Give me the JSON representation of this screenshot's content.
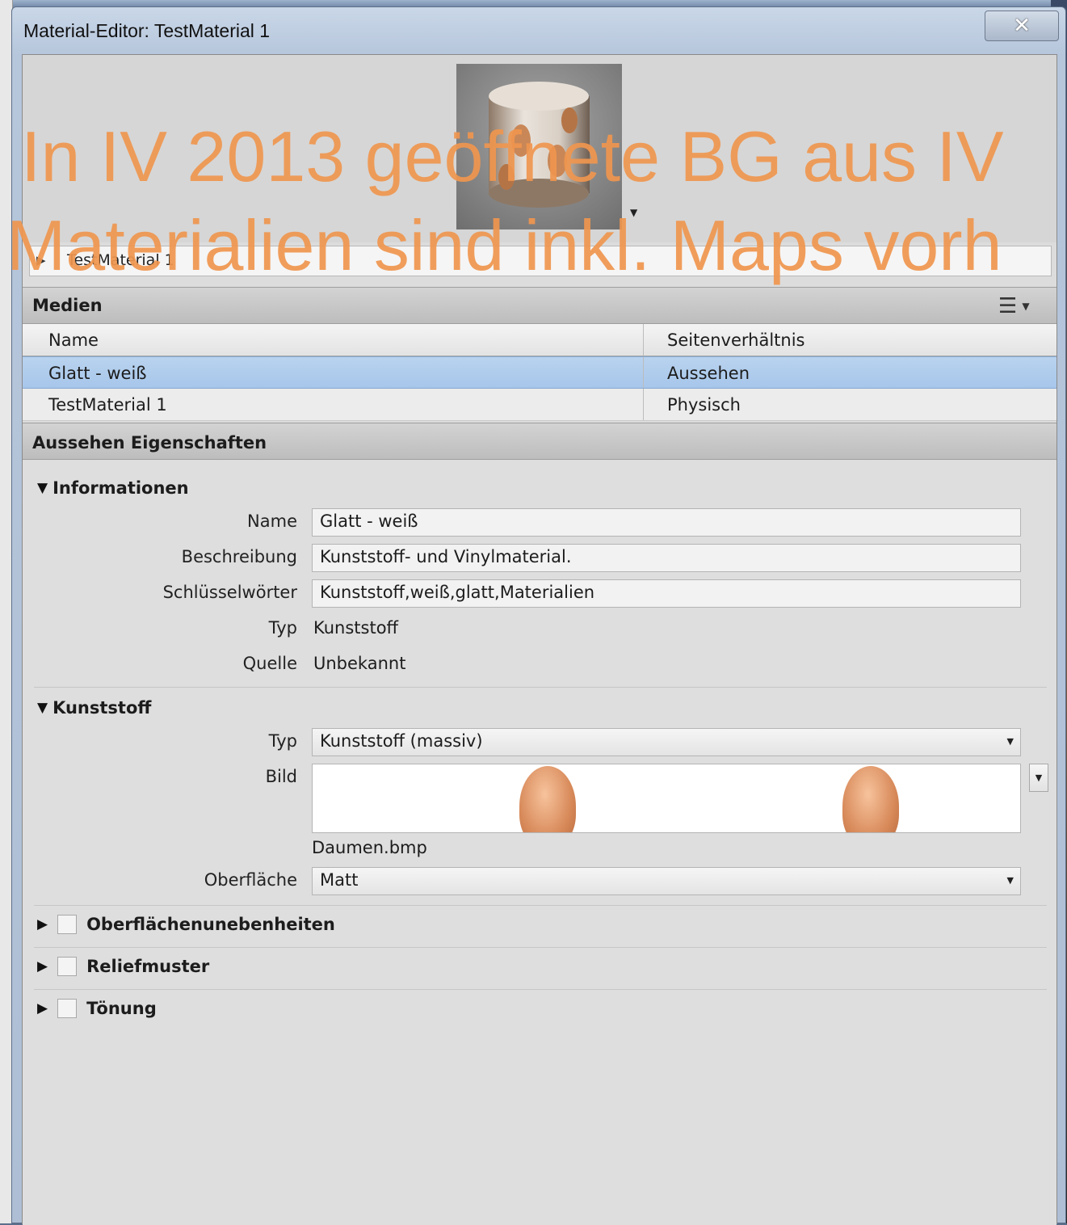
{
  "window": {
    "title": "Material-Editor: TestMaterial 1",
    "close_label": "✕"
  },
  "preview": {
    "material_name": "TestMaterial 1",
    "dropdown_glyph": "▼",
    "expand_glyph": "▶"
  },
  "overlay": {
    "line1": "In IV 2013 geöffnete BG aus IV",
    "line2": "Materialien sind inkl. Maps vorh"
  },
  "medien": {
    "title": "Medien",
    "view_icon": "list-view-icon",
    "columns": [
      "Name",
      "Seitenverhältnis"
    ],
    "rows": [
      {
        "name": "Glatt - weiß",
        "aspect": "Aussehen",
        "selected": true
      },
      {
        "name": "TestMaterial 1",
        "aspect": "Physisch",
        "selected": false
      }
    ]
  },
  "properties": {
    "title": "Aussehen Eigenschaften",
    "informationen": {
      "heading": "Informationen",
      "name_label": "Name",
      "name_value": "Glatt - weiß",
      "beschreibung_label": "Beschreibung",
      "beschreibung_value": "Kunststoff- und Vinylmaterial.",
      "schluessel_label": "Schlüsselwörter",
      "schluessel_value": "Kunststoff,weiß,glatt,Materialien",
      "typ_label": "Typ",
      "typ_value": "Kunststoff",
      "quelle_label": "Quelle",
      "quelle_value": "Unbekannt"
    },
    "kunststoff": {
      "heading": "Kunststoff",
      "typ_label": "Typ",
      "typ_value": "Kunststoff (massiv)",
      "bild_label": "Bild",
      "bild_file": "Daumen.bmp",
      "oberflaeche_label": "Oberfläche",
      "oberflaeche_value": "Matt"
    },
    "collapsed": [
      {
        "label": "Oberflächenunebenheiten",
        "checked": false
      },
      {
        "label": "Reliefmuster",
        "checked": false
      },
      {
        "label": "Tönung",
        "checked": false
      }
    ]
  },
  "colors": {
    "overlay_text": "#f0964f",
    "selection": "#a7c6ea"
  }
}
